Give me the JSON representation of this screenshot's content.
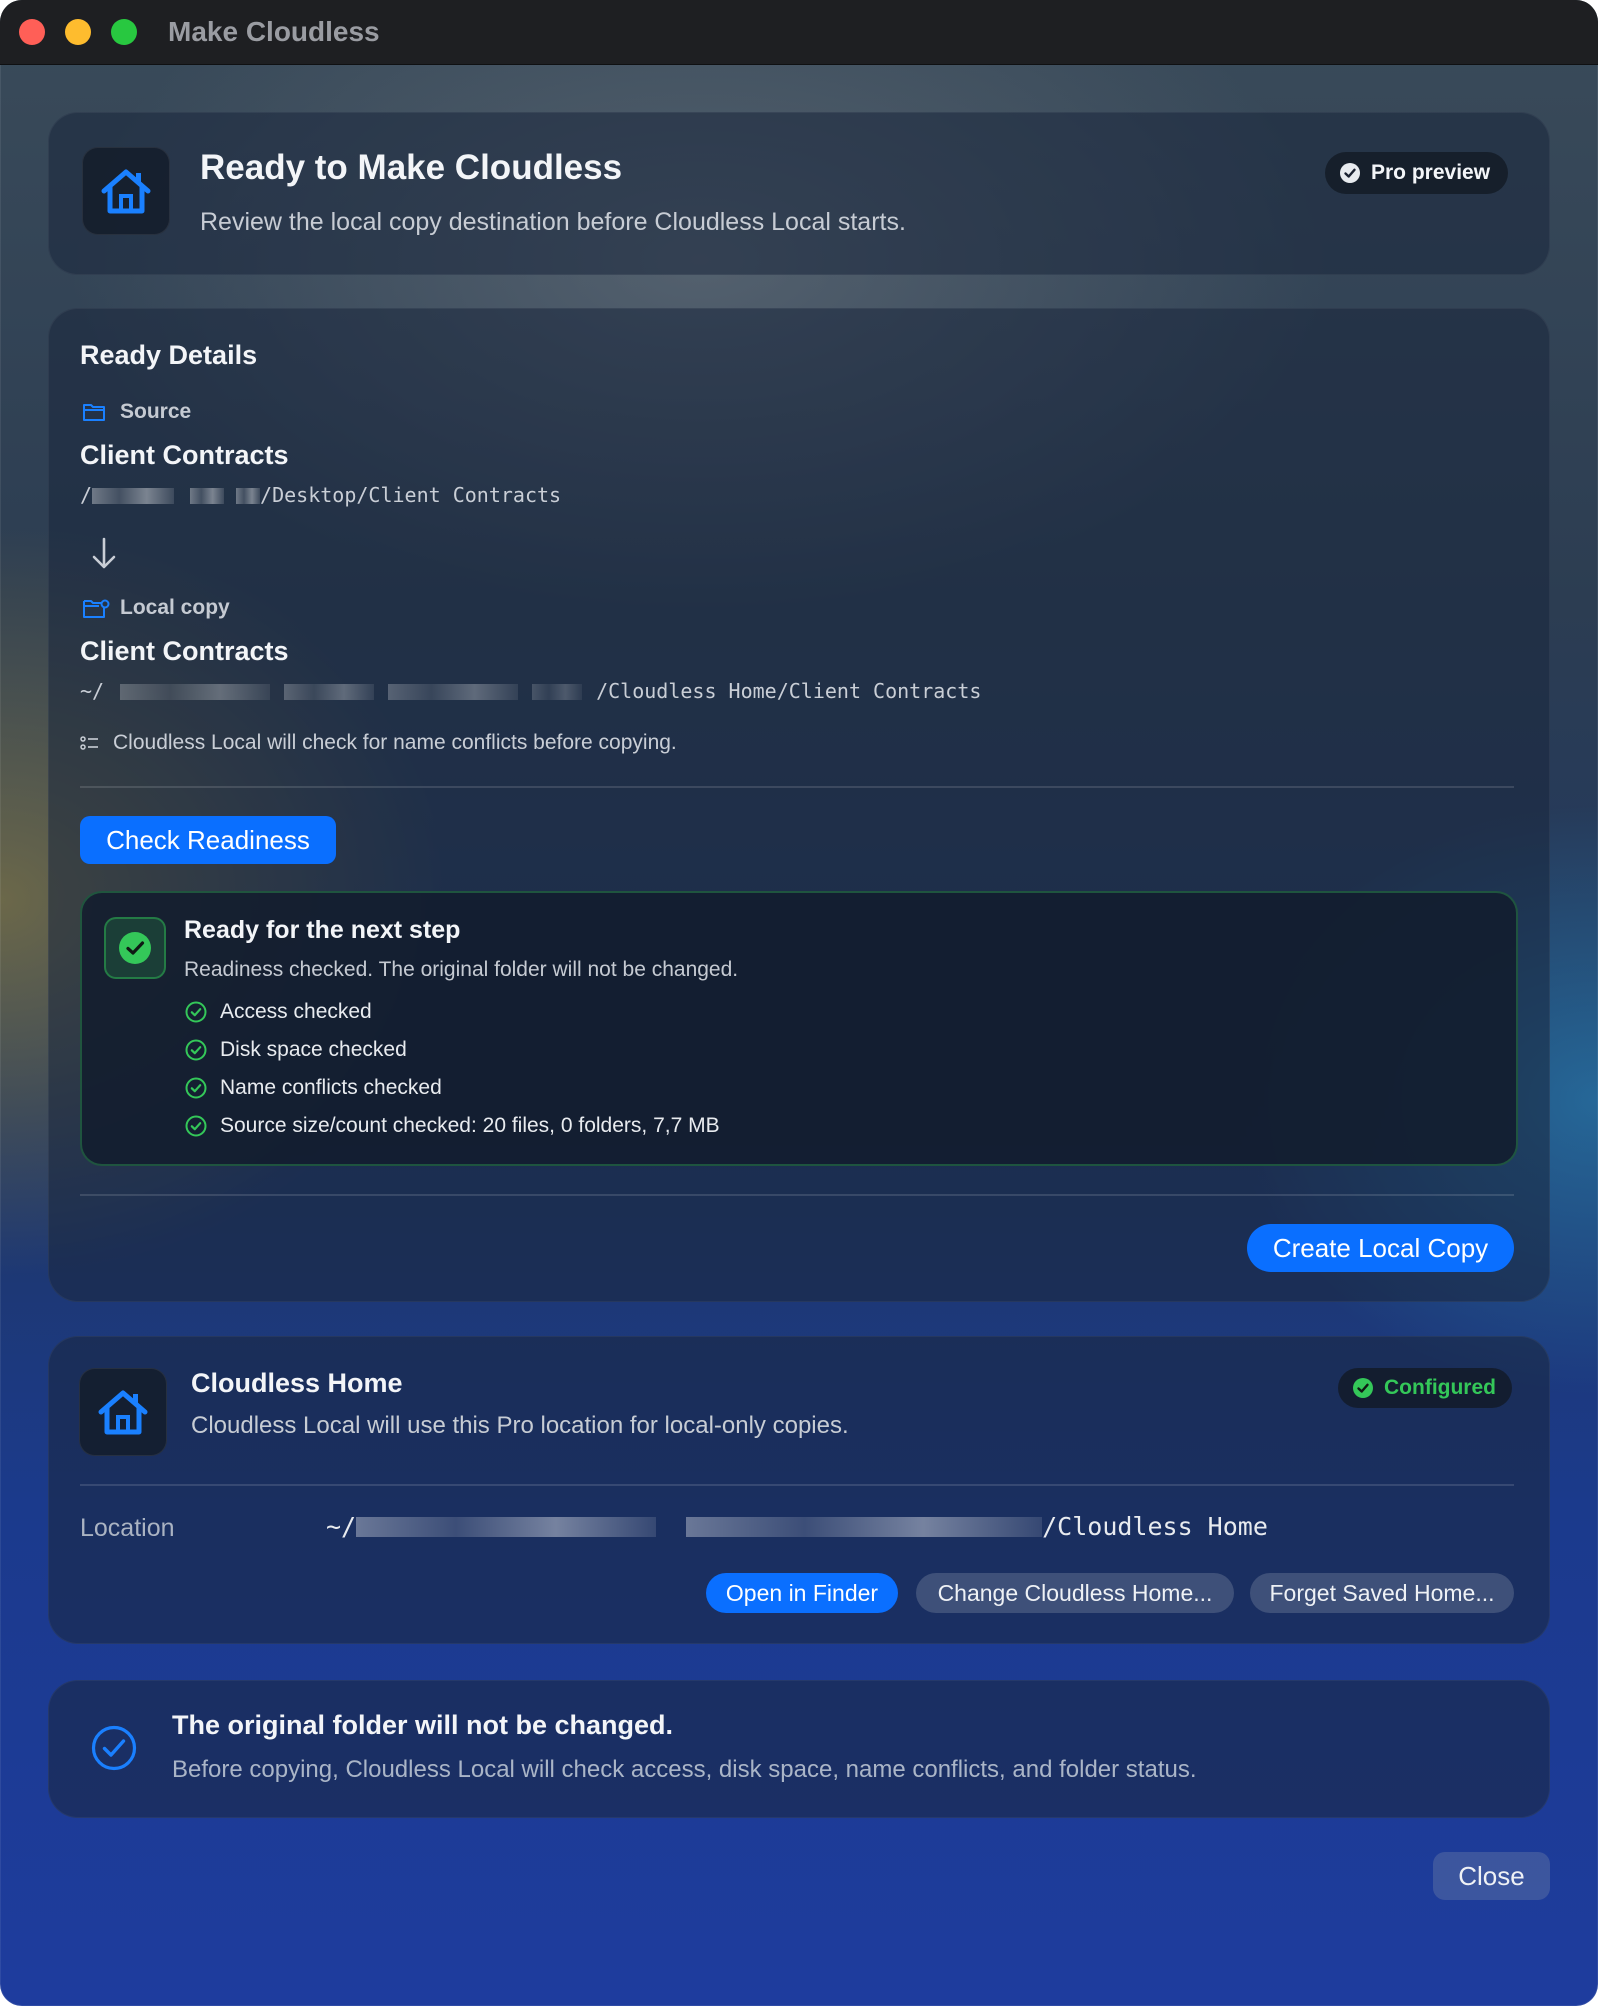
{
  "window": {
    "title": "Make Cloudless"
  },
  "header": {
    "title": "Ready to Make Cloudless",
    "subtitle": "Review the local copy destination before Cloudless Local starts.",
    "badge": "Pro preview"
  },
  "details": {
    "title": "Ready Details",
    "source": {
      "label": "Source",
      "name": "Client Contracts",
      "path_prefix": "/",
      "path_suffix": "/Desktop/Client Contracts"
    },
    "local_copy": {
      "label": "Local copy",
      "name": "Client Contracts",
      "path_prefix": "~/",
      "path_suffix": "/Cloudless Home/Client Contracts"
    },
    "conflict_note": "Cloudless Local will check for name conflicts before copying.",
    "check_button": "Check Readiness",
    "ready": {
      "title": "Ready for the next step",
      "subtitle": "Readiness checked. The original folder will not be changed.",
      "checks": [
        "Access checked",
        "Disk space checked",
        "Name conflicts checked",
        "Source size/count checked: 20 files, 0 folders, 7,7 MB"
      ]
    },
    "create_button": "Create Local Copy"
  },
  "home": {
    "title": "Cloudless Home",
    "subtitle": "Cloudless Local will use this Pro location for local-only copies.",
    "badge": "Configured",
    "location_label": "Location",
    "path_prefix": "~/",
    "path_suffix": "/Cloudless Home",
    "buttons": {
      "open": "Open in Finder",
      "change": "Change Cloudless Home...",
      "forget": "Forget Saved Home..."
    }
  },
  "notice": {
    "title": "The original folder will not be changed.",
    "text": "Before copying, Cloudless Local will check access, disk space, name conflicts, and folder status."
  },
  "footer": {
    "close_button": "Close"
  },
  "colors": {
    "accent": "#0a6fff",
    "success": "#34c759",
    "close": "#ff5f57",
    "minimize": "#febc2e",
    "zoom": "#28c840"
  },
  "icons": [
    "house-icon",
    "checkmark-circle-icon",
    "folder-icon",
    "arrow-down-icon",
    "folder-badge-icon",
    "list-icon",
    "checkmark-square-icon"
  ]
}
